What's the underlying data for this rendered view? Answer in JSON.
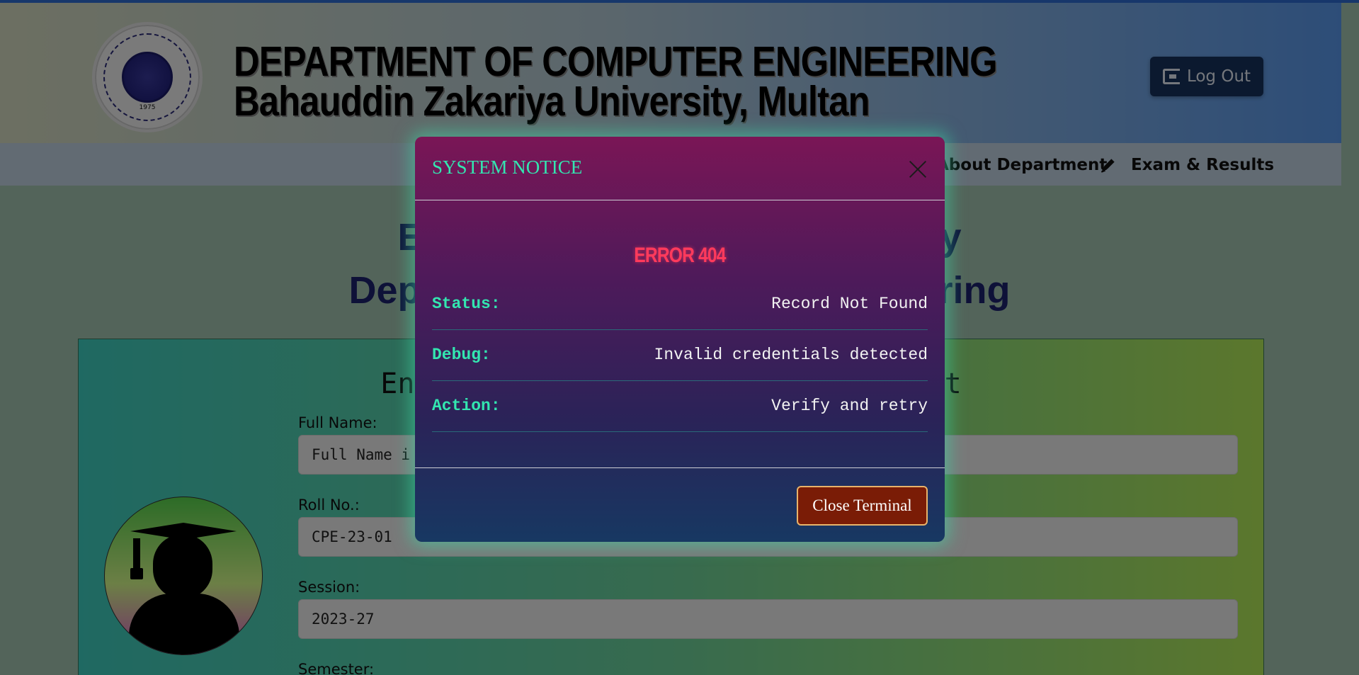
{
  "header": {
    "title_line1": "DEPARTMENT OF COMPUTER ENGINEERING",
    "title_line2": "Bahauddin Zakariya University, Multan",
    "logo_year": "1975",
    "logout_label": "Log Out"
  },
  "nav": {
    "items": [
      {
        "label": "About Department"
      },
      {
        "label": "Exam & Results"
      }
    ]
  },
  "main": {
    "title_line1_left": "Ex",
    "title_line1_right": "y",
    "title_line2_left": "Depa",
    "title_line2_right": "ring"
  },
  "form": {
    "heading_left": "Ent",
    "heading_right": "lt",
    "fields": [
      {
        "label": "Full Name:",
        "value": "Full Name i"
      },
      {
        "label": "Roll No.:",
        "value": "CPE-23-01"
      },
      {
        "label": "Session:",
        "value": "2023-27"
      },
      {
        "label": "Semester:",
        "value": ""
      }
    ]
  },
  "modal": {
    "title": "SYSTEM NOTICE",
    "error": "ERROR 404",
    "rows": [
      {
        "key": "Status:",
        "value": "Record Not Found"
      },
      {
        "key": "Debug:",
        "value": "Invalid credentials detected"
      },
      {
        "key": "Action:",
        "value": "Verify and retry"
      }
    ],
    "close_button": "Close Terminal"
  },
  "colors": {
    "accent_green": "#33e6b0",
    "error_red": "#ff3a5c",
    "close_button_bg": "#7a1c06"
  },
  "icons": [
    "logout-icon",
    "pen-icon",
    "close-icon",
    "graduate-avatar-icon",
    "university-logo"
  ]
}
